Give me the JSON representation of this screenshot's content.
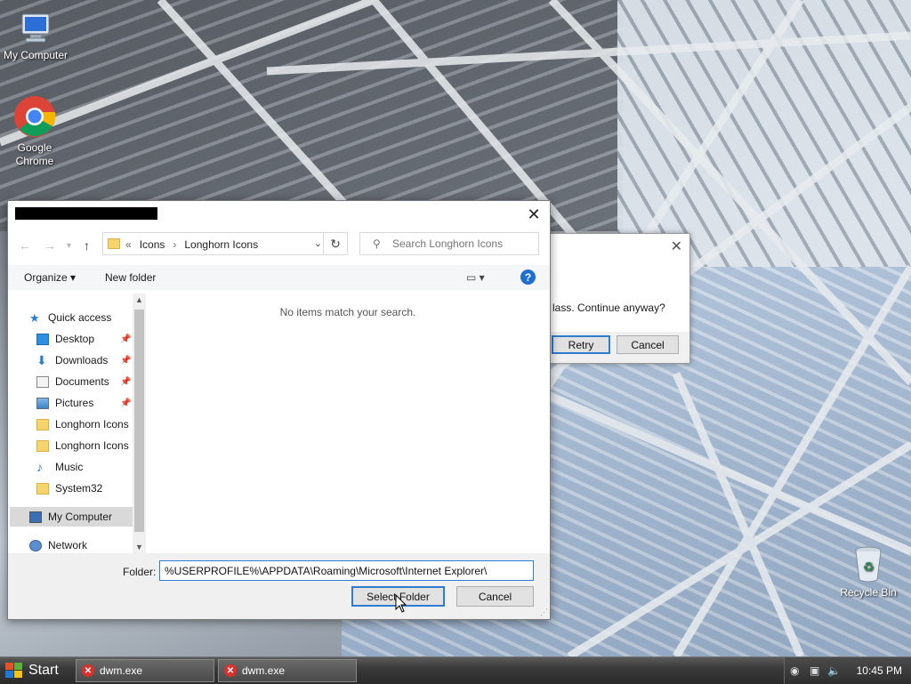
{
  "desktop": {
    "icons": [
      {
        "label": "My Computer"
      },
      {
        "label": "Google Chrome"
      },
      {
        "label": "Recycle Bin"
      }
    ]
  },
  "background_dialog": {
    "message": "lass. Continue anyway?",
    "retry_label": "Retry",
    "cancel_label": "Cancel"
  },
  "dialog": {
    "close_icon": "close-icon",
    "address": {
      "overflow": "«",
      "crumbs": [
        "Icons",
        "Longhorn Icons"
      ]
    },
    "search": {
      "placeholder": "Search Longhorn Icons"
    },
    "commands": {
      "organize": "Organize",
      "organize_arrow": "▾",
      "new_folder": "New folder"
    },
    "nav_items": [
      {
        "label": "Quick access",
        "icon": "star-icon",
        "pinned": false
      },
      {
        "label": "Desktop",
        "icon": "desktop-icon",
        "pinned": true
      },
      {
        "label": "Downloads",
        "icon": "download-icon",
        "pinned": true
      },
      {
        "label": "Documents",
        "icon": "document-icon",
        "pinned": true
      },
      {
        "label": "Pictures",
        "icon": "picture-icon",
        "pinned": true
      },
      {
        "label": "Longhorn Icons",
        "icon": "folder-icon",
        "pinned": false
      },
      {
        "label": "Longhorn Icons",
        "icon": "folder-icon",
        "pinned": false
      },
      {
        "label": "Music",
        "icon": "music-icon",
        "pinned": false
      },
      {
        "label": "System32",
        "icon": "folder-icon",
        "pinned": false
      },
      {
        "label": "My Computer",
        "icon": "computer-icon",
        "pinned": false,
        "selected": true
      },
      {
        "label": "Network",
        "icon": "network-icon",
        "pinned": false
      }
    ],
    "empty_message": "No items match your search.",
    "folder_label": "Folder:",
    "folder_value": "%USERPROFILE%\\APPDATA\\Roaming\\Microsoft\\Internet Explorer\\",
    "select_folder_label": "Select Folder",
    "cancel_label": "Cancel"
  },
  "taskbar": {
    "start_label": "Start",
    "tasks": [
      {
        "label": "dwm.exe"
      },
      {
        "label": "dwm.exe"
      }
    ],
    "clock": "10:45 PM"
  },
  "colors": {
    "accent": "#2e7bd0",
    "folder": "#f5d46b",
    "error": "#d9302b"
  }
}
